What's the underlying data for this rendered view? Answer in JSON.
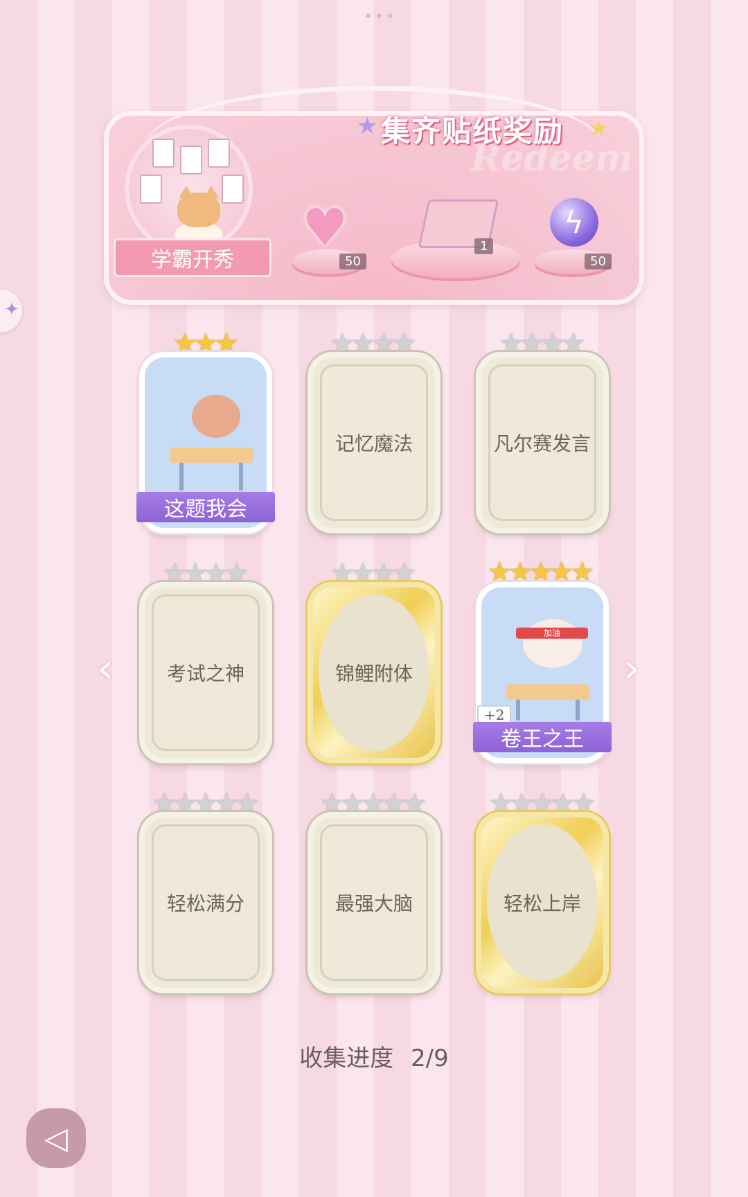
{
  "banner": {
    "title": "集齐贴纸奖励",
    "watermark": "Redeem",
    "hero_label": "学霸开秀",
    "rewards": [
      {
        "icon": "heart-gem-icon",
        "count": "50"
      },
      {
        "icon": "gift-box-icon",
        "count": "1"
      },
      {
        "icon": "lightning-orb-icon",
        "count": "50"
      }
    ]
  },
  "cards": [
    {
      "name": "这题我会",
      "stars_on": 3,
      "stars_total": 3,
      "state": "owned"
    },
    {
      "name": "记忆魔法",
      "stars_on": 0,
      "stars_total": 4,
      "state": "locked"
    },
    {
      "name": "凡尔赛发言",
      "stars_on": 0,
      "stars_total": 4,
      "state": "locked"
    },
    {
      "name": "考试之神",
      "stars_on": 0,
      "stars_total": 4,
      "state": "locked"
    },
    {
      "name": "锦鲤附体",
      "stars_on": 0,
      "stars_total": 4,
      "state": "locked-gold"
    },
    {
      "name": "卷王之王",
      "stars_on": 5,
      "stars_total": 5,
      "state": "owned",
      "badge": "+2",
      "headband": "加油"
    },
    {
      "name": "轻松满分",
      "stars_on": 0,
      "stars_total": 5,
      "state": "locked"
    },
    {
      "name": "最强大脑",
      "stars_on": 0,
      "stars_total": 5,
      "state": "locked"
    },
    {
      "name": "轻松上岸",
      "stars_on": 0,
      "stars_total": 5,
      "state": "locked-gold"
    }
  ],
  "progress": {
    "label": "收集进度",
    "value": "2/9"
  },
  "colors": {
    "accent_purple": "#8d63d6",
    "star_gold": "#f5c642",
    "bg_pink": "#f7d9e3"
  }
}
